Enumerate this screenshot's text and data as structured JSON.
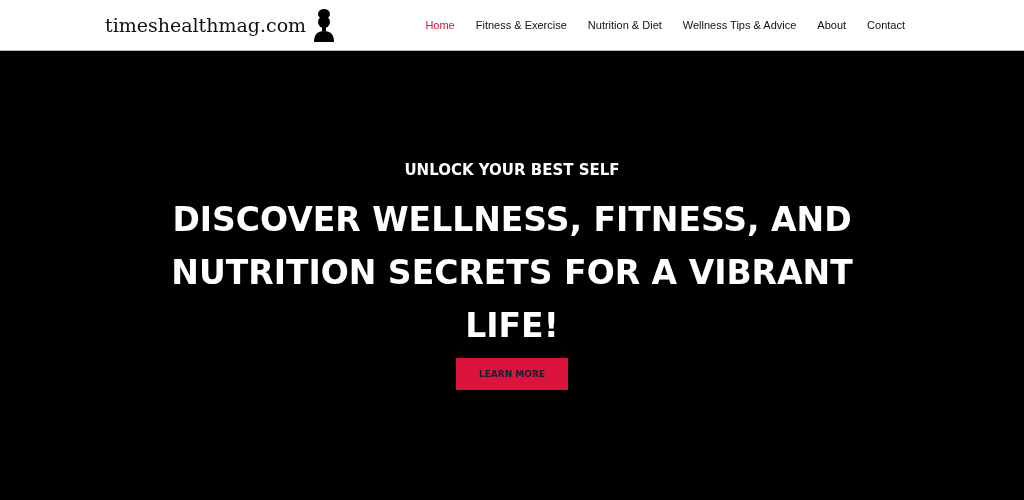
{
  "header": {
    "logo": "timeshealthmag.com",
    "nav": [
      {
        "label": "Home",
        "selected": true
      },
      {
        "label": "Fitness & Exercise",
        "selected": false
      },
      {
        "label": "Nutrition & Diet",
        "selected": false
      },
      {
        "label": "Wellness Tips & Advice",
        "selected": false
      },
      {
        "label": "About",
        "selected": false
      },
      {
        "label": "Contact",
        "selected": false
      }
    ]
  },
  "hero": {
    "eyebrow": "UNLOCK YOUR BEST SELF",
    "heading": "DISCOVER WELLNESS, FITNESS, AND NUTRITION SECRETS FOR A VIBRANT LIFE!",
    "button": "LEARN MORE"
  }
}
